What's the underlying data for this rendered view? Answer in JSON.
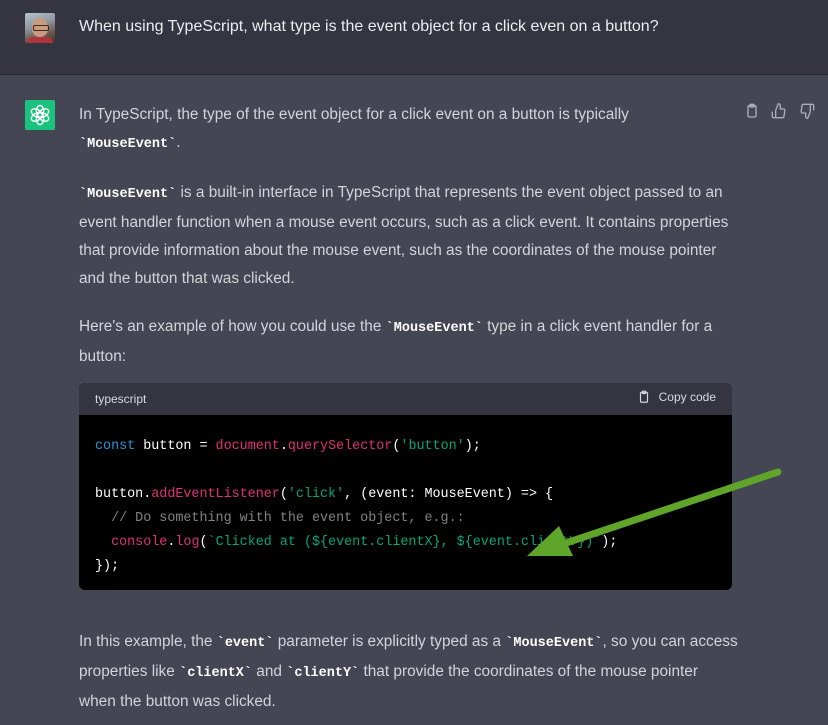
{
  "user": {
    "question": "When using TypeScript, what type is the event object for a click even on a button?"
  },
  "assistant": {
    "intro_a": "In TypeScript, the type of the event object for a click event on a button is typically ",
    "intro_code": "`MouseEvent`",
    "intro_b": ".",
    "para2_code": "`MouseEvent`",
    "para2_text": " is a built-in interface in TypeScript that represents the event object passed to an event handler function when a mouse event occurs, such as a click event. It contains properties that provide information about the mouse event, such as the coordinates of the mouse pointer and the button that was clicked.",
    "para3_a": "Here's an example of how you could use the ",
    "para3_code": "`MouseEvent`",
    "para3_b": " type in a click event handler for a button:",
    "code": {
      "language": "typescript",
      "copy_label": "Copy code",
      "line1_kw": "const",
      "line1_a": " button = ",
      "line1_obj": "document",
      "line1_dot": ".",
      "line1_fn": "querySelector",
      "line1_p1": "(",
      "line1_str": "'button'",
      "line1_p2": ");",
      "line3_a": "button.",
      "line3_fn": "addEventListener",
      "line3_p1": "(",
      "line3_str": "'click'",
      "line3_b": ", (event: MouseEvent) => {",
      "line4_cmt": "  // Do something with the event object, e.g.:",
      "line5_indent": "  ",
      "line5_obj": "console",
      "line5_dot": ".",
      "line5_fn": "log",
      "line5_p1": "(",
      "line5_str": "`Clicked at (${event.clientX}, ${event.clientY})`",
      "line5_p2": ");",
      "line6": "});"
    },
    "outro_a": "In this example, the ",
    "outro_code1": "`event`",
    "outro_b": " parameter is explicitly typed as a ",
    "outro_code2": "`MouseEvent`",
    "outro_c": ", so you can access properties like ",
    "outro_code3": "`clientX`",
    "outro_d": " and ",
    "outro_code4": "`clientY`",
    "outro_e": " that provide the coordinates of the mouse pointer when the button was clicked."
  },
  "icons": {
    "logo": "openai-logo-icon",
    "copy": "clipboard-icon",
    "like": "thumbs-up-icon",
    "dislike": "thumbs-down-icon",
    "annotation": "green-arrow-annotation"
  },
  "colors": {
    "logo_bg": "#19c37d",
    "arrow": "#5fa52a",
    "keyword": "#2e95d3",
    "function": "#df3079",
    "string": "#00a67d"
  }
}
